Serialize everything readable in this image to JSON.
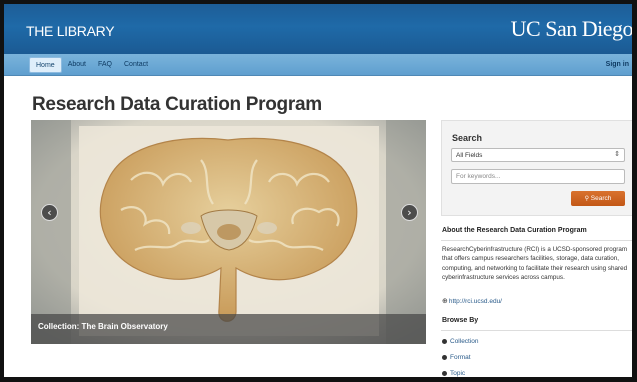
{
  "header": {
    "brand": "THE LIBRARY",
    "university": "UC San Diego",
    "background": "#1f6aa8"
  },
  "nav": {
    "items": [
      {
        "label": "Home",
        "active": true
      },
      {
        "label": "About",
        "active": false
      },
      {
        "label": "FAQ",
        "active": false
      },
      {
        "label": "Contact",
        "active": false
      }
    ],
    "signin": "Sign in"
  },
  "page": {
    "title": "Research Data Curation Program"
  },
  "carousel": {
    "caption": "Collection: The Brain Observatory",
    "prev_icon": "chevron-left-icon",
    "next_icon": "chevron-right-icon"
  },
  "search": {
    "title": "Search",
    "field_selected": "All Fields",
    "keyword_placeholder": "For keywords...",
    "button_label": "Search",
    "button_color": "#c9611d"
  },
  "about": {
    "title": "About the Research Data Curation Program",
    "body": "ResearchCyberinfrastructure (RCI) is a UCSD-sponsored program that offers campus researchers facilities, storage, data curation, computing, and networking to facilitate their research using shared cyberinfrastructure services across campus.",
    "link": "http://rci.ucsd.edu/"
  },
  "browse": {
    "title": "Browse By",
    "items": [
      "Collection",
      "Format",
      "Topic"
    ]
  }
}
